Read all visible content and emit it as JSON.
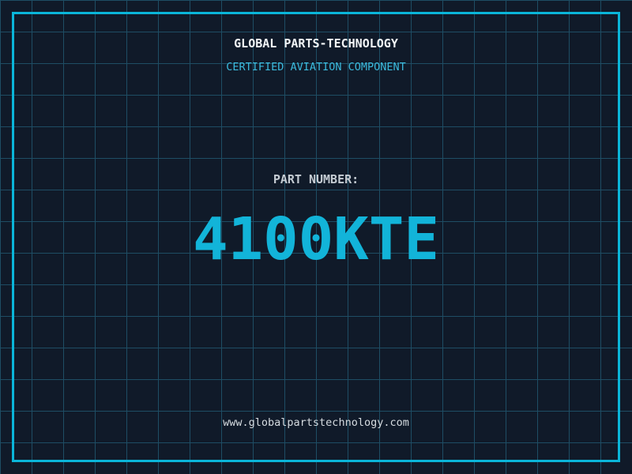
{
  "colors": {
    "background": "#101a29",
    "grid_line": "#1e4d64",
    "frame": "#0ab5d9",
    "title": "#f2f5f7",
    "subtitle": "#3bbadd",
    "label": "#c5ccd3",
    "number": "#12b4d9",
    "url": "#d5dbe0"
  },
  "header": {
    "title": "GLOBAL PARTS-TECHNOLOGY",
    "subtitle": "CERTIFIED AVIATION COMPONENT"
  },
  "part": {
    "label": "PART NUMBER:",
    "number": "4100KTE"
  },
  "footer": {
    "url": "www.globalpartstechnology.com"
  }
}
